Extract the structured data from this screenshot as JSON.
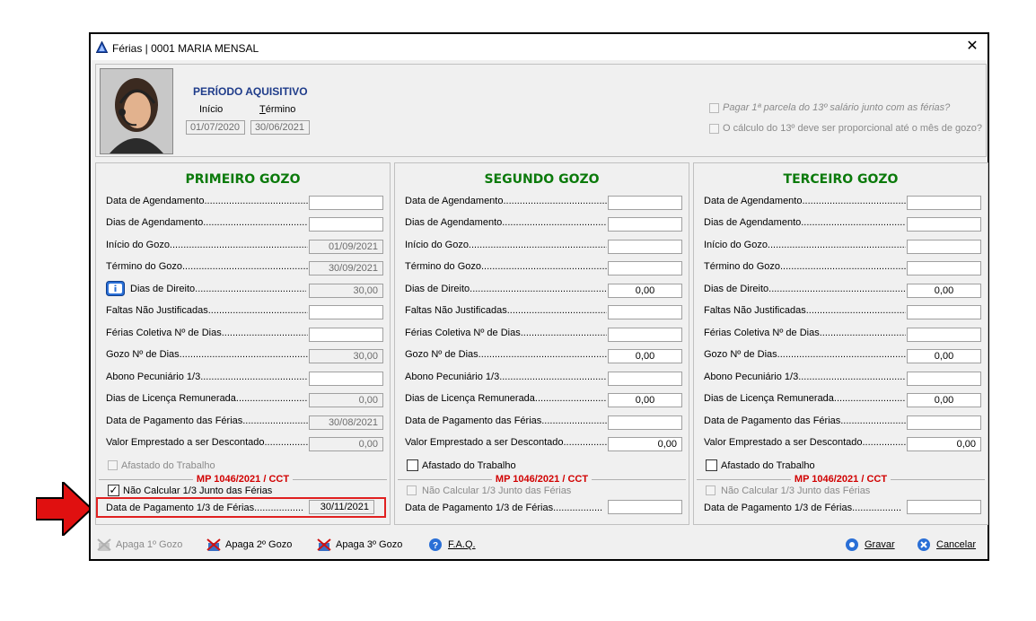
{
  "window": {
    "title": "Férias | 0001 MARIA MENSAL",
    "close_glyph": "✕"
  },
  "periodo": {
    "title": "PERÍODO AQUISITIVO",
    "inicio_label": "Início",
    "termino_label": "Término",
    "inicio": "01/07/2020",
    "termino": "30/06/2021"
  },
  "options": {
    "opt1": "Pagar 1ª parcela do 13º salário junto com as férias?",
    "opt2": "O cálculo do 13º deve ser proporcional até o mês de gozo?"
  },
  "labels": {
    "data_agendamento": "Data de Agendamento.......................................................",
    "dias_agendamento": "Dias de Agendamento.......................................................",
    "inicio_gozo": "Início do Gozo........................................................................",
    "termino_gozo": "Término do Gozo.....................................................................",
    "dias_direito": "Dias de Direito........................................................................",
    "faltas": "Faltas Não Justificadas...........................................................",
    "ferias_coletiva": "Férias Coletiva Nº de Dias.....................................................",
    "gozo_dias": "Gozo Nº de Dias......................................................................",
    "abono": "Abono Pecuniário 1/3..............................................................",
    "licenca": "Dias de Licença Remunerada...................................................",
    "data_pagamento": "Data de Pagamento das Férias.................................................",
    "valor_emprestado": "Valor Emprestado a ser Descontado..........................................",
    "afastado": "Afastado do Trabalho",
    "mp": "MP 1046/2021 / CCT",
    "nao_calcular": "Não Calcular 1/3 Junto das Férias",
    "data_pag_terco": "Data de Pagamento 1/3 de Férias......................................",
    "dias_direito_short": "Dias de Direito..............................................................."
  },
  "gozos": [
    {
      "title": "PRIMEIRO GOZO",
      "values": [
        "",
        "",
        "01/09/2021",
        "30/09/2021",
        "30,00",
        "",
        "",
        "30,00",
        "",
        "0,00",
        "30/08/2021",
        "0,00"
      ],
      "data_pag_terco": "30/11/2021"
    },
    {
      "title": "SEGUNDO GOZO",
      "values": [
        "",
        "",
        "",
        "",
        "0,00",
        "",
        "",
        "0,00",
        "",
        "0,00",
        "",
        "0,00"
      ],
      "data_pag_terco": ""
    },
    {
      "title": "TERCEIRO GOZO",
      "values": [
        "",
        "",
        "",
        "",
        "0,00",
        "",
        "",
        "0,00",
        "",
        "0,00",
        "",
        "0,00"
      ],
      "data_pag_terco": ""
    }
  ],
  "buttons": {
    "apaga1": "Apaga 1º Gozo",
    "apaga2": "Apaga 2º Gozo",
    "apaga3": "Apaga 3º Gozo",
    "faq": "F.A.Q.",
    "gravar": "Gravar",
    "cancelar": "Cancelar"
  },
  "colors": {
    "accent_green": "#0b7a0b",
    "mp_red": "#d10000",
    "title_blue": "#1f3c8a",
    "highlight_red": "#e02020"
  }
}
